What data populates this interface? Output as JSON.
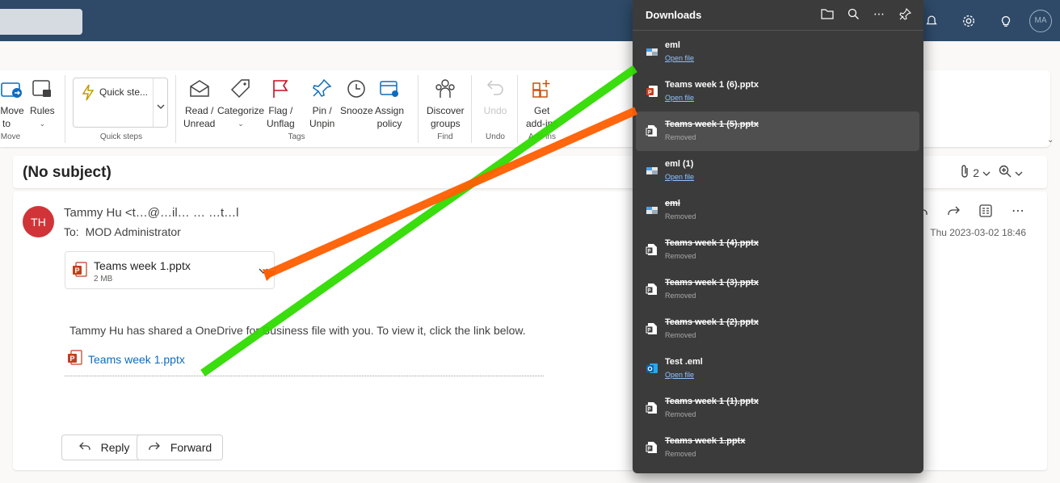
{
  "topbar": {
    "avatar_initials": "MA",
    "icons": [
      "notification-icon",
      "gear-icon",
      "lightbulb-icon"
    ]
  },
  "ribbon": {
    "move": {
      "label1": "Move",
      "label2": "to",
      "group": "Move"
    },
    "rules": {
      "label": "Rules"
    },
    "quick_steps": {
      "label": "Quick ste...",
      "group": "Quick steps"
    },
    "read_unread": {
      "label1": "Read /",
      "label2": "Unread"
    },
    "categorize": {
      "label": "Categorize"
    },
    "flag": {
      "label1": "Flag /",
      "label2": "Unflag"
    },
    "pin": {
      "label1": "Pin /",
      "label2": "Unpin"
    },
    "snooze": {
      "label": "Snooze"
    },
    "assign_policy": {
      "label1": "Assign",
      "label2": "policy"
    },
    "tags_group": "Tags",
    "discover_groups": {
      "label1": "Discover",
      "label2": "groups",
      "group": "Find"
    },
    "undo": {
      "label": "Undo",
      "group": "Undo"
    },
    "get_addins": {
      "label1": "Get",
      "label2": "add-ins",
      "group": "Add-ins"
    }
  },
  "message": {
    "subject": "(No subject)",
    "attachment_count": "2",
    "sender_initials": "TH",
    "sender_name": "Tammy Hu <t…@…il…  …  …t…l",
    "to_label": "To:",
    "to_value": "MOD Administrator",
    "date": "Thu 2023-03-02 18:46",
    "attachment": {
      "name": "Teams week 1.pptx",
      "size": "2 MB"
    },
    "body": "Tammy Hu has shared a OneDrive for Business file with you. To view it, click the link below.",
    "link_text": "Teams week 1.pptx",
    "reply_label": "Reply",
    "forward_label": "Forward"
  },
  "downloads": {
    "title": "Downloads",
    "items": [
      {
        "name": "eml",
        "sub": "Open file",
        "removed": false,
        "icon": "eml-icon"
      },
      {
        "name": "Teams week 1 (6).pptx",
        "sub": "Open file",
        "removed": false,
        "icon": "pptx-icon"
      },
      {
        "name": "Teams week 1 (5).pptx",
        "sub": "Removed",
        "removed": true,
        "icon": "file-icon"
      },
      {
        "name": "eml (1)",
        "sub": "Open file",
        "removed": false,
        "icon": "eml-icon"
      },
      {
        "name": "eml",
        "sub": "Removed",
        "removed": true,
        "icon": "eml-icon"
      },
      {
        "name": "Teams week 1 (4).pptx",
        "sub": "Removed",
        "removed": true,
        "icon": "file-icon"
      },
      {
        "name": "Teams week 1 (3).pptx",
        "sub": "Removed",
        "removed": true,
        "icon": "file-icon"
      },
      {
        "name": "Teams week 1 (2).pptx",
        "sub": "Removed",
        "removed": true,
        "icon": "file-icon"
      },
      {
        "name": "Test .eml",
        "sub": "Open file",
        "removed": false,
        "icon": "outlook-icon"
      },
      {
        "name": "Teams week 1 (1).pptx",
        "sub": "Removed",
        "removed": true,
        "icon": "file-icon"
      },
      {
        "name": "Teams week 1.pptx",
        "sub": "Removed",
        "removed": true,
        "icon": "file-icon"
      }
    ]
  },
  "colors": {
    "topbar": "#2e4a68",
    "panel": "#3b3b3b",
    "link": "#0f6cbd",
    "avatar": "#d13438",
    "green_stroke": "#2fdb00",
    "orange_stroke": "#ff5e00"
  }
}
